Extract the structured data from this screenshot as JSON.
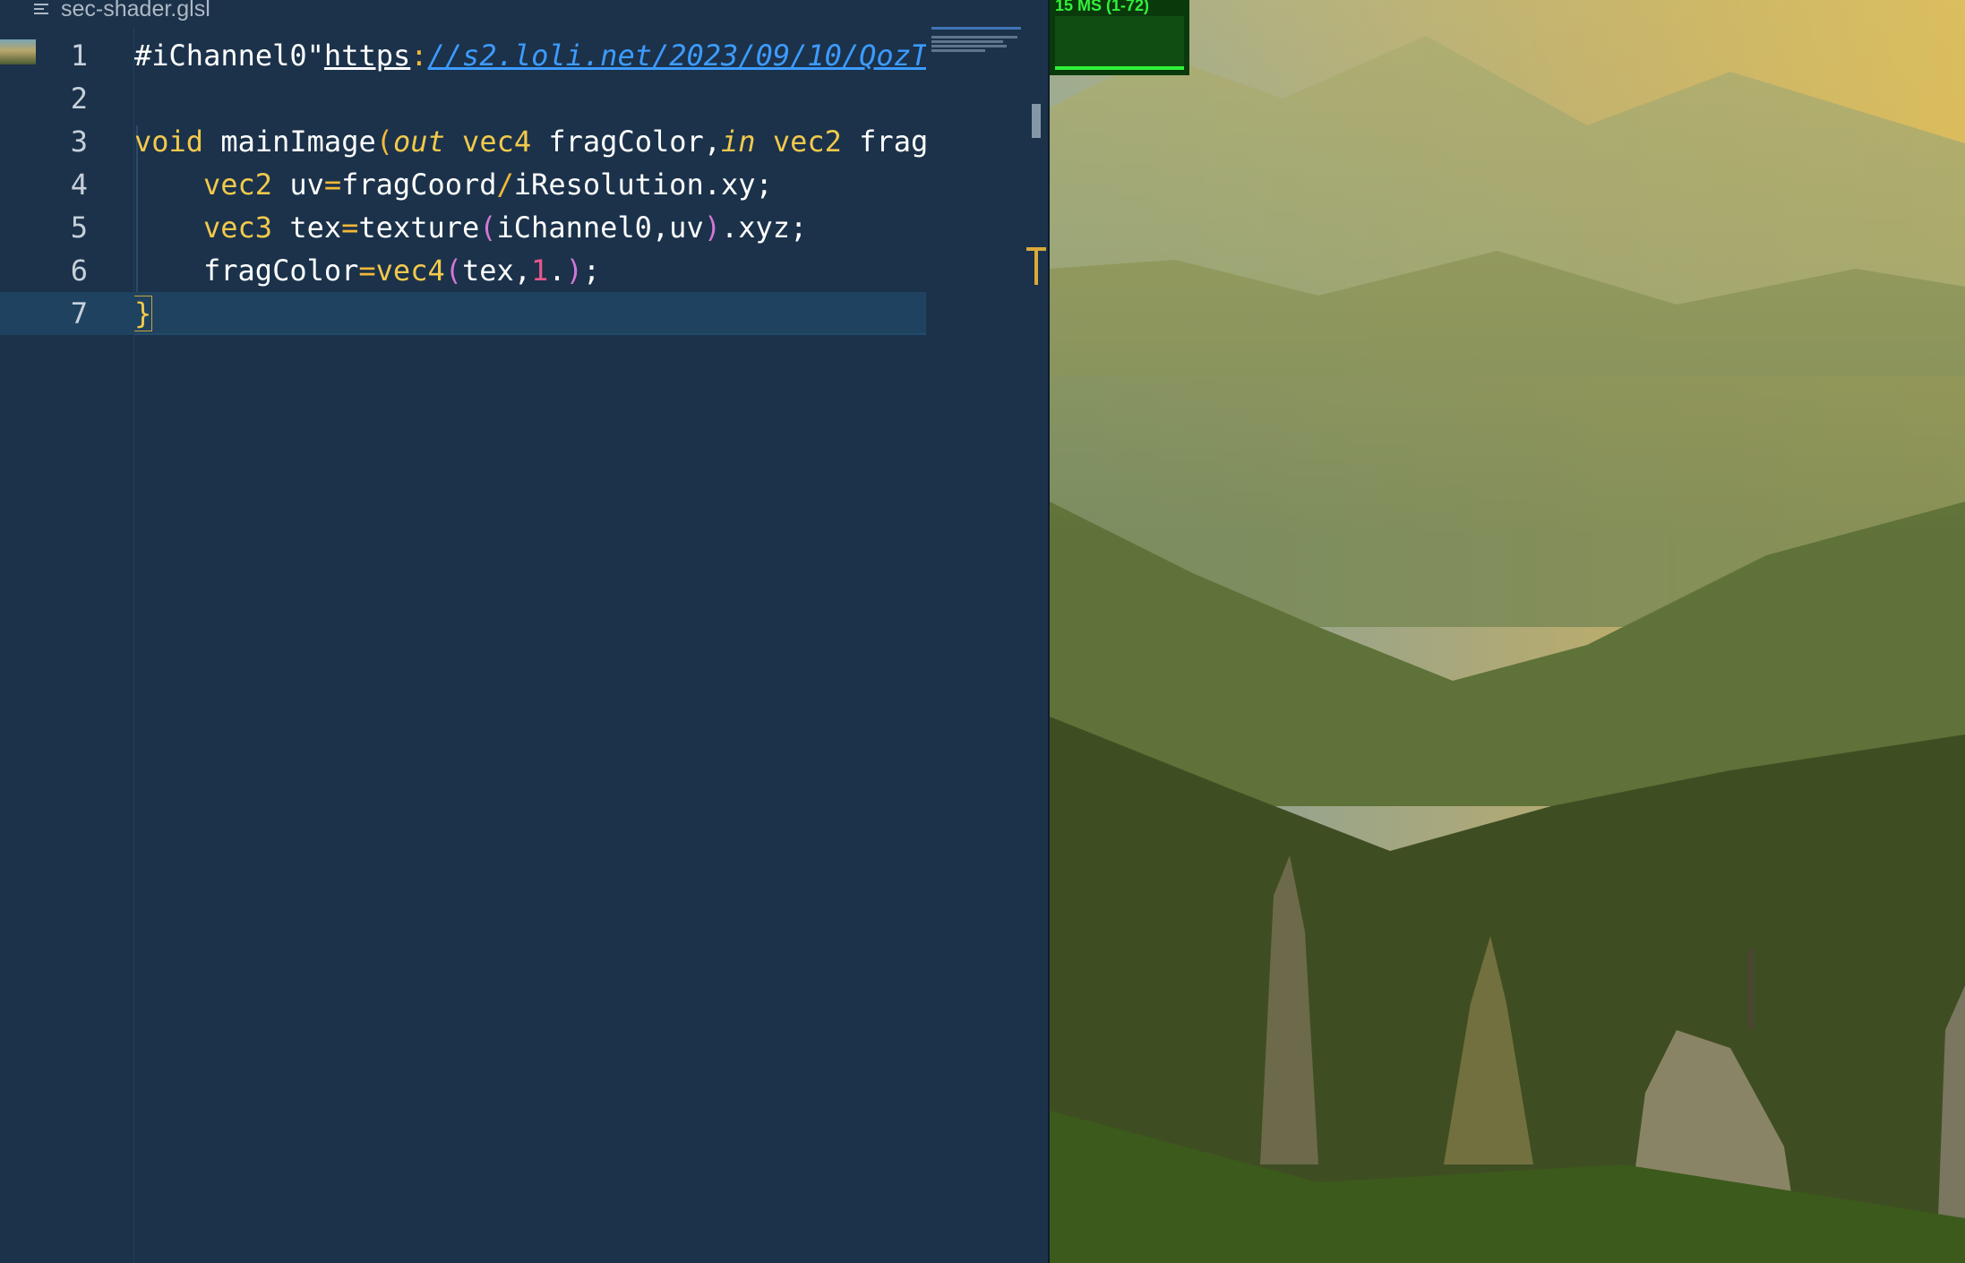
{
  "breadcrumb": {
    "file": "sec-shader.glsl"
  },
  "editor": {
    "line_numbers": [
      "1",
      "2",
      "3",
      "4",
      "5",
      "6",
      "7"
    ],
    "lines": [
      {
        "parts": [
          {
            "t": "#iChannel0\"",
            "c": ""
          },
          {
            "t": "https",
            "c": "uline"
          },
          {
            "t": ":",
            "c": "op"
          },
          {
            "t": "//s2.loli.net/2023/09/10/QozT",
            "c": "url"
          }
        ]
      },
      {
        "parts": []
      },
      {
        "parts": [
          {
            "t": "void",
            "c": "kw"
          },
          {
            "t": " mainImage",
            "c": ""
          },
          {
            "t": "(",
            "c": "op"
          },
          {
            "t": "out",
            "c": "it"
          },
          {
            "t": " ",
            "c": ""
          },
          {
            "t": "vec4",
            "c": "kw"
          },
          {
            "t": " fragColor,",
            "c": ""
          },
          {
            "t": "in",
            "c": "it"
          },
          {
            "t": " ",
            "c": ""
          },
          {
            "t": "vec2",
            "c": "kw"
          },
          {
            "t": " frag",
            "c": ""
          }
        ]
      },
      {
        "indent": true,
        "parts": [
          {
            "t": "vec2",
            "c": "kw"
          },
          {
            "t": " uv",
            "c": ""
          },
          {
            "t": "=",
            "c": "op"
          },
          {
            "t": "fragCoord",
            "c": ""
          },
          {
            "t": "/",
            "c": "op"
          },
          {
            "t": "iResolution.xy;",
            "c": ""
          }
        ]
      },
      {
        "indent": true,
        "parts": [
          {
            "t": "vec3",
            "c": "kw"
          },
          {
            "t": " tex",
            "c": ""
          },
          {
            "t": "=",
            "c": "op"
          },
          {
            "t": "texture",
            "c": ""
          },
          {
            "t": "(",
            "c": "pn"
          },
          {
            "t": "iChannel0,uv",
            "c": ""
          },
          {
            "t": ")",
            "c": "pn"
          },
          {
            "t": ".xyz;",
            "c": ""
          }
        ]
      },
      {
        "indent": true,
        "parts": [
          {
            "t": "fragColor",
            "c": ""
          },
          {
            "t": "=",
            "c": "op"
          },
          {
            "t": "vec4",
            "c": "kw"
          },
          {
            "t": "(",
            "c": "pn"
          },
          {
            "t": "tex,",
            "c": ""
          },
          {
            "t": "1",
            "c": "nm"
          },
          {
            "t": ".",
            "c": ""
          },
          {
            "t": ")",
            "c": "pn"
          },
          {
            "t": ";",
            "c": ""
          }
        ]
      },
      {
        "current": true,
        "parts": [
          {
            "t": "}",
            "c": "brace"
          }
        ]
      }
    ]
  },
  "preview": {
    "stats_label": "15 MS (1-72)"
  },
  "colors": {
    "editor_bg": "#1b324a",
    "keyword": "#f2c94c",
    "url": "#3d9bff",
    "number": "#e8578a",
    "paren": "#d277d6",
    "stats_text": "#31f23a"
  },
  "icons": [
    "file-icon",
    "thumbnail-icon"
  ]
}
